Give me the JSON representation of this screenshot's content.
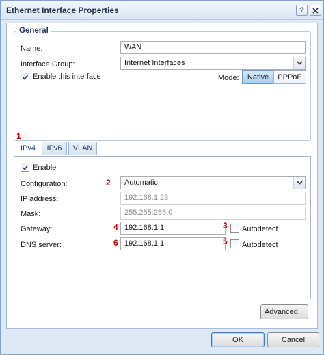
{
  "window": {
    "title": "Ethernet Interface Properties",
    "help_label": "?",
    "close_label": "X"
  },
  "general": {
    "group_title": "General",
    "name_label": "Name:",
    "name_value": "WAN",
    "interface_group_label": "Interface Group:",
    "interface_group_value": "Internet Interfaces",
    "enable_interface_label": "Enable this interface",
    "enable_interface_checked": true,
    "mode_label": "Mode:",
    "mode_options": [
      "Native",
      "PPPoE"
    ],
    "mode_selected": "Native"
  },
  "tabs": [
    "IPv4",
    "IPv6",
    "VLAN"
  ],
  "active_tab": "IPv4",
  "ipv4": {
    "enable_label": "Enable",
    "enable_checked": true,
    "configuration_label": "Configuration:",
    "configuration_value": "Automatic",
    "ip_address_label": "IP address:",
    "ip_address_value": "192.168.1.23",
    "mask_label": "Mask:",
    "mask_value": "255.255.255.0",
    "gateway_label": "Gateway:",
    "gateway_value": "192.168.1.1",
    "gateway_autodetect_label": "Autodetect",
    "dns_label": "DNS server:",
    "dns_value": "192.168.1.1",
    "dns_autodetect_label": "Autodetect"
  },
  "annotations": [
    "1",
    "2",
    "3",
    "4",
    "5",
    "6"
  ],
  "buttons": {
    "advanced": "Advanced...",
    "ok": "OK",
    "cancel": "Cancel"
  },
  "colors": {
    "annotation_red": "#d40000",
    "title_text": "#1e2f4d",
    "accent_blue": "#6c9bd2"
  }
}
